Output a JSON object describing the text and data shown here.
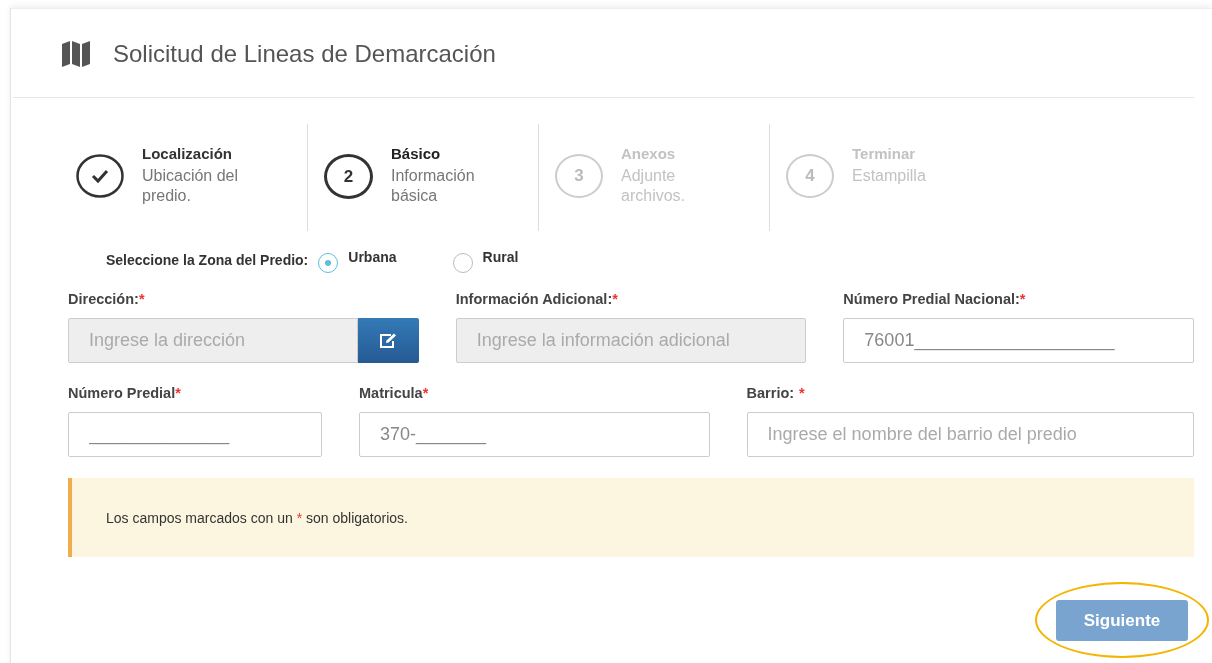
{
  "header": {
    "title": "Solicitud de Lineas de Demarcación"
  },
  "steps": [
    {
      "completed": true,
      "selected": false,
      "disabled": false,
      "title": "Localización",
      "subtitle": "Ubicación del predio."
    },
    {
      "number": "2",
      "completed": false,
      "selected": true,
      "disabled": false,
      "title": "Básico",
      "subtitle": "Información básica"
    },
    {
      "number": "3",
      "completed": false,
      "selected": false,
      "disabled": true,
      "title": "Anexos",
      "subtitle": "Adjunte archivos."
    },
    {
      "number": "4",
      "completed": false,
      "selected": false,
      "disabled": true,
      "title": "Terminar",
      "subtitle": "Estampilla"
    }
  ],
  "zone": {
    "label": "Seleccione la Zona del Predio:",
    "options": [
      {
        "label": "Urbana",
        "selected": true
      },
      {
        "label": "Rural",
        "selected": false
      }
    ]
  },
  "field_rows": [
    [
      {
        "label": "Dirección:",
        "mark": "*",
        "spaced": false,
        "placeholder": "Ingrese la dirección",
        "disabled": true,
        "kind": "with-button"
      },
      {
        "label": "Información Adicional:",
        "mark": "*",
        "spaced": false,
        "placeholder": "Ingrese la información adicional",
        "disabled": true,
        "kind": "plain"
      },
      {
        "label": "Número Predial Nacional:",
        "mark": "*",
        "spaced": false,
        "value": "76001____________________",
        "disabled": false,
        "kind": "plain"
      }
    ],
    [
      {
        "label": "Número Predial",
        "mark": "*",
        "spaced": false,
        "value": "______________",
        "disabled": false,
        "kind": "plain"
      },
      {
        "label": "Matricula",
        "mark": "*",
        "spaced": false,
        "value": "370-_______",
        "disabled": false,
        "kind": "plain"
      },
      {
        "label": "Barrio:",
        "mark": "*",
        "spaced": true,
        "placeholder": "Ingrese el nombre del barrio del predio",
        "disabled": false,
        "kind": "plain"
      }
    ]
  ],
  "notice": {
    "before": "Los campos marcados con un",
    "mark": "*",
    "after": "son obligatorios."
  },
  "next_button": {
    "label": "Siguiente",
    "highlighted": true
  }
}
